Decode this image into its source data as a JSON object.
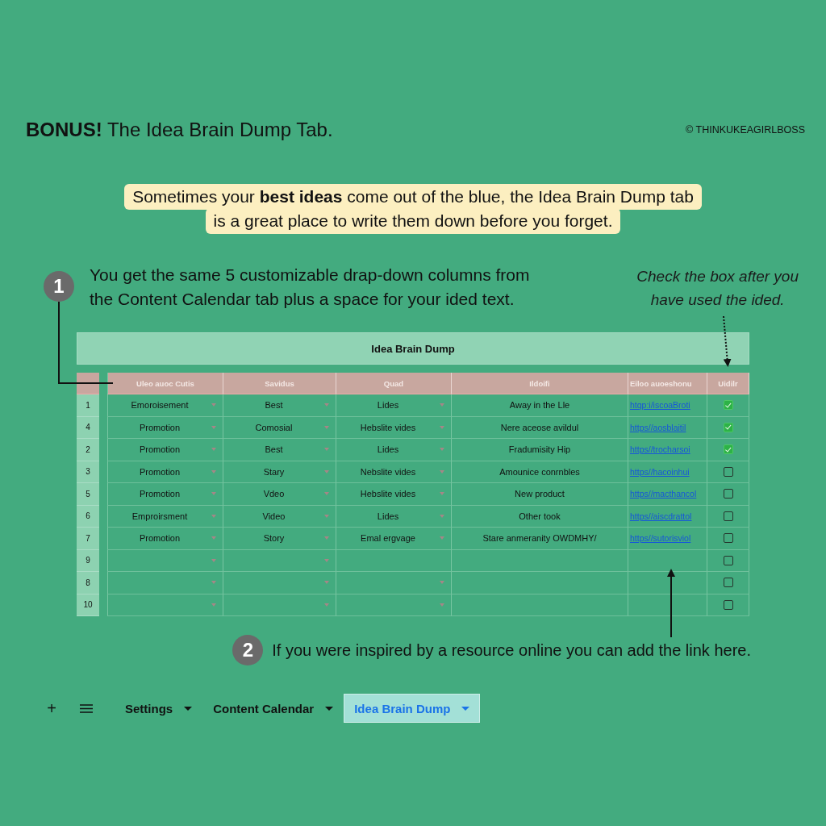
{
  "header": {
    "title": "**BONUS!** The Idea Brain Dump Tab.",
    "credit": "© THINKUKEAGIRLBOSS"
  },
  "intro": [
    "Sometimes your **best ideas** come out of the blue, the Idea Brain Dump tab",
    "is a great place to write them down before you forget."
  ],
  "callouts": [
    {
      "number": "1",
      "text": "You get the same 5 customizable drap-down columns from\nthe Content Calendar tab plus a space for your ided text."
    },
    {
      "number": "2",
      "text": "If you were inspired by a resource online you can add the link here."
    }
  ],
  "note": "Check the box after you\nhave used the ided.",
  "sheet": {
    "title": "Idea Brain Dump",
    "columns": [
      "Uleo auoc Cutis",
      "Savidus",
      "Quad",
      "Ildoifi",
      "Eiloo auoeshonu",
      "Uidilr"
    ],
    "rows": [
      {
        "number": "1",
        "cells": [
          {
            "kind": "dropdown",
            "value": "Emoroisement"
          },
          {
            "kind": "dropdown",
            "value": "Best"
          },
          {
            "kind": "dropdown",
            "value": "Lides"
          },
          {
            "kind": "text",
            "value": "Away in the Lle"
          },
          {
            "kind": "link",
            "value": "htqp:i/iscoaBroti"
          },
          {
            "kind": "checkbox",
            "checked": true
          }
        ]
      },
      {
        "number": "4",
        "cells": [
          {
            "kind": "dropdown",
            "value": "Promotion"
          },
          {
            "kind": "dropdown",
            "value": "Comosial"
          },
          {
            "kind": "dropdown",
            "value": "Hebslite vides"
          },
          {
            "kind": "text",
            "value": "Nere aceose avildul"
          },
          {
            "kind": "link",
            "value": "https//aosblaitil"
          },
          {
            "kind": "checkbox",
            "checked": true
          }
        ]
      },
      {
        "number": "2",
        "cells": [
          {
            "kind": "dropdown",
            "value": "Promotion"
          },
          {
            "kind": "dropdown",
            "value": "Best"
          },
          {
            "kind": "dropdown",
            "value": "Lides"
          },
          {
            "kind": "text",
            "value": "Fradumisity Hip"
          },
          {
            "kind": "link",
            "value": "https//trocharsoi"
          },
          {
            "kind": "checkbox",
            "checked": true
          }
        ]
      },
      {
        "number": "3",
        "cells": [
          {
            "kind": "dropdown",
            "value": "Promotion"
          },
          {
            "kind": "dropdown",
            "value": "Stary"
          },
          {
            "kind": "dropdown",
            "value": "Nebslite vides"
          },
          {
            "kind": "text",
            "value": "Amounice conrnbles"
          },
          {
            "kind": "link",
            "value": "https//hacoinhui"
          },
          {
            "kind": "checkbox",
            "checked": false
          }
        ]
      },
      {
        "number": "5",
        "cells": [
          {
            "kind": "dropdown",
            "value": "Promotion"
          },
          {
            "kind": "dropdown",
            "value": "Vdeo"
          },
          {
            "kind": "dropdown",
            "value": "Hebslite vides"
          },
          {
            "kind": "text",
            "value": "New product"
          },
          {
            "kind": "link",
            "value": "https//macthancol"
          },
          {
            "kind": "checkbox",
            "checked": false
          }
        ]
      },
      {
        "number": "6",
        "cells": [
          {
            "kind": "dropdown",
            "value": "Emproirsment"
          },
          {
            "kind": "dropdown",
            "value": "Video"
          },
          {
            "kind": "dropdown",
            "value": "Lides"
          },
          {
            "kind": "text",
            "value": "Other took"
          },
          {
            "kind": "link",
            "value": "https//aiscdrattol"
          },
          {
            "kind": "checkbox",
            "checked": false
          }
        ]
      },
      {
        "number": "7",
        "cells": [
          {
            "kind": "dropdown",
            "value": "Promotion"
          },
          {
            "kind": "dropdown",
            "value": "Story"
          },
          {
            "kind": "dropdown",
            "value": "Emal ergvage"
          },
          {
            "kind": "text",
            "value": "Stare anmeranity OWDMHY/"
          },
          {
            "kind": "link",
            "value": "https//sutorisviol"
          },
          {
            "kind": "checkbox",
            "checked": false
          }
        ]
      },
      {
        "number": "9",
        "cells": [
          {
            "kind": "dropdown"
          },
          {
            "kind": "dropdown"
          },
          {
            "kind": "text"
          },
          {
            "kind": "text"
          },
          {
            "kind": "link"
          },
          {
            "kind": "checkbox",
            "checked": false
          }
        ]
      },
      {
        "number": "8",
        "cells": [
          {
            "kind": "dropdown"
          },
          {
            "kind": "dropdown"
          },
          {
            "kind": "dropdown"
          },
          {
            "kind": "text"
          },
          {
            "kind": "link"
          },
          {
            "kind": "checkbox",
            "checked": false
          }
        ]
      },
      {
        "number": "10",
        "cells": [
          {
            "kind": "dropdown"
          },
          {
            "kind": "dropdown"
          },
          {
            "kind": "dropdown"
          },
          {
            "kind": "text"
          },
          {
            "kind": "link"
          },
          {
            "kind": "checkbox",
            "checked": false
          }
        ]
      }
    ]
  },
  "add_button": "+",
  "tabs": [
    {
      "label": "Settings",
      "selected": false
    },
    {
      "label": "Content Calendar",
      "selected": false
    },
    {
      "label": "Idea Brain Dump",
      "selected": true
    }
  ]
}
